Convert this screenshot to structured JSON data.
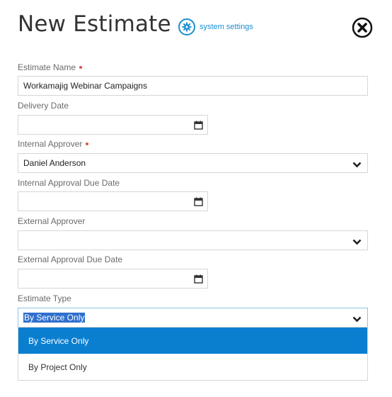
{
  "header": {
    "title": "New Estimate",
    "settings_label": "system settings",
    "settings_icon": "gear-icon",
    "close_icon": "close-icon"
  },
  "colors": {
    "accent": "#1a8fd1",
    "required": "#d9534f",
    "dropdown_highlight": "#0a7fd0"
  },
  "form": {
    "estimate_name": {
      "label": "Estimate Name",
      "required": true,
      "value": "Workamajig Webinar Campaigns"
    },
    "delivery_date": {
      "label": "Delivery Date",
      "value": "",
      "icon": "calendar-icon"
    },
    "internal_approver": {
      "label": "Internal Approver",
      "required": true,
      "value": "Daniel Anderson",
      "icon": "chevron-down-icon"
    },
    "internal_due": {
      "label": "Internal Approval Due Date",
      "value": "",
      "icon": "calendar-icon"
    },
    "external_approver": {
      "label": "External Approver",
      "value": "",
      "icon": "chevron-down-icon"
    },
    "external_due": {
      "label": "External Approval Due Date",
      "value": "",
      "icon": "calendar-icon"
    },
    "estimate_type": {
      "label": "Estimate Type",
      "value": "By Service Only",
      "icon": "chevron-down-icon",
      "options": [
        "By Service Only",
        "By Project Only"
      ],
      "highlighted_index": 0
    }
  }
}
